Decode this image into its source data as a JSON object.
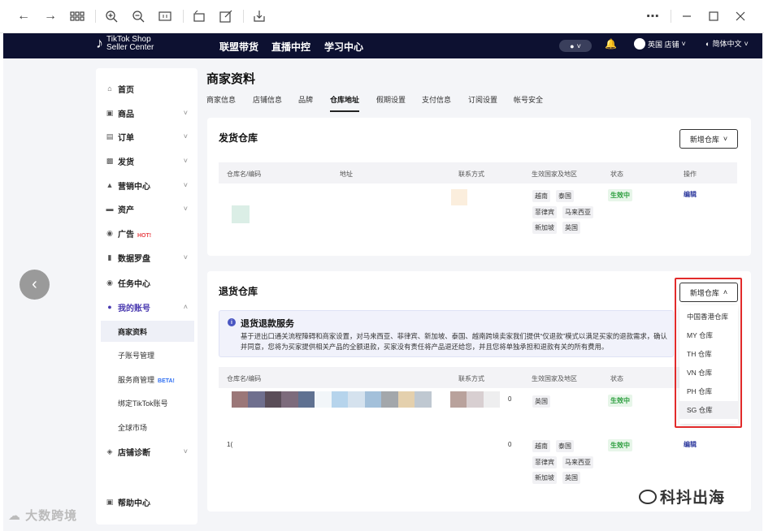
{
  "browser": {
    "icons": [
      "back-icon",
      "forward-icon",
      "apps-icon",
      "zoom-in-icon",
      "zoom-out-icon",
      "fit-icon",
      "rotate-icon",
      "edit-icon",
      "download-icon",
      "more-icon",
      "minimize-icon",
      "maximize-icon",
      "close-icon"
    ]
  },
  "header": {
    "logo_line1": "TikTok Shop",
    "logo_line2": "Seller Center",
    "nav": [
      "联盟带货",
      "直播中控",
      "学习中心"
    ],
    "shop_label": "英国 店铺",
    "lang_label": "简体中文"
  },
  "sidebar": {
    "items": [
      {
        "label": "首页",
        "icon": "home-icon"
      },
      {
        "label": "商品",
        "icon": "box-icon"
      },
      {
        "label": "订单",
        "icon": "order-icon"
      },
      {
        "label": "发货",
        "icon": "truck-icon"
      },
      {
        "label": "营销中心",
        "icon": "megaphone-icon"
      },
      {
        "label": "资产",
        "icon": "card-icon"
      },
      {
        "label": "广告",
        "icon": "ad-icon",
        "badge": "HOT!"
      },
      {
        "label": "数据罗盘",
        "icon": "chart-icon"
      },
      {
        "label": "任务中心",
        "icon": "medal-icon"
      },
      {
        "label": "我的账号",
        "icon": "user-icon"
      }
    ],
    "sub_items": [
      {
        "label": "商家资料"
      },
      {
        "label": "子账号管理"
      },
      {
        "label": "服务商管理",
        "badge": "BETA!"
      },
      {
        "label": "绑定TikTok账号"
      },
      {
        "label": "全球市场"
      }
    ],
    "diag": {
      "label": "店铺诊断",
      "icon": "shield-icon"
    },
    "help": {
      "label": "帮助中心",
      "icon": "help-icon"
    }
  },
  "main": {
    "title": "商家资料",
    "tabs": [
      "商家信息",
      "店铺信息",
      "品牌",
      "仓库地址",
      "假期设置",
      "支付信息",
      "订阅设置",
      "帐号安全"
    ],
    "active_tab": "仓库地址"
  },
  "shipping": {
    "title": "发货仓库",
    "add_button": "新增仓库",
    "columns": [
      "仓库名/编码",
      "地址",
      "联系方式",
      "生效国家及地区",
      "状态",
      "操作"
    ],
    "row": {
      "regions": [
        "越南",
        "泰国",
        "菲律宾",
        "马来西亚",
        "新加坡",
        "英国"
      ],
      "status": "生效中",
      "action": "编辑"
    }
  },
  "returns": {
    "title": "退货仓库",
    "add_button": "新增仓库",
    "info_title": "退货退款服务",
    "info_text": "基于进出口通关流程障碍和商家设置，对马来西亚、菲律宾、新加坡、泰国、越南跨境卖家我们提供“仅退款”模式以满足买家的退款需求，确认并同意，您将为买家提供相关产品的全额退款，买家没有责任将产品退还给您，并且您将单独承担和退款有关的所有费用。",
    "columns": [
      "仓库名/编码",
      "地址",
      "联系方式",
      "生效国家及地区",
      "状态",
      "操作"
    ],
    "row1": {
      "fragment": "0",
      "regions": [
        "英国"
      ],
      "status": "生效中"
    },
    "row2": {
      "prefix": "1(",
      "fragment": "0",
      "regions": [
        "越南",
        "泰国",
        "菲律宾",
        "马来西亚",
        "新加坡",
        "英国"
      ],
      "status": "生效中",
      "action": "编辑"
    }
  },
  "dropdown": {
    "items": [
      "中国香港仓库",
      "MY 仓库",
      "TH 仓库",
      "VN 仓库",
      "PH 仓库",
      "SG 仓库"
    ],
    "selected": "SG 仓库"
  },
  "watermarks": {
    "left": "大数跨境",
    "right": "科抖出海"
  }
}
